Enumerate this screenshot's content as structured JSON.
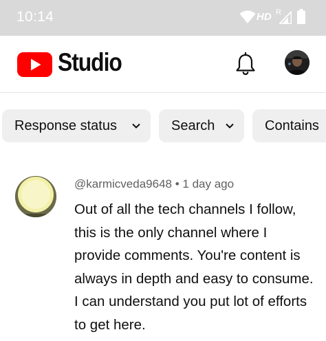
{
  "status_bar": {
    "time": "10:14",
    "hd": "HD",
    "roaming": "R",
    "icons": [
      "wifi-icon",
      "signal-icon",
      "battery-icon"
    ]
  },
  "app_bar": {
    "brand": "Studio",
    "icons": [
      "youtube-logo-icon",
      "bell-icon",
      "avatar"
    ]
  },
  "filters": {
    "chips": [
      {
        "label": "Response status"
      },
      {
        "label": "Search"
      },
      {
        "label": "Contains"
      }
    ]
  },
  "comment": {
    "author": "@karmicveda9648",
    "separator": "•",
    "time_ago": "1 day ago",
    "text": "Out of all the tech channels I follow, this is the only channel where I provide comments. You're content is always in depth and easy to consume. I can understand you put lot of efforts to get here."
  },
  "colors": {
    "brand_red": "#ff0000",
    "status_bar": "#d9d9d9",
    "chip_bg": "#efefef",
    "meta_text": "#606060"
  }
}
